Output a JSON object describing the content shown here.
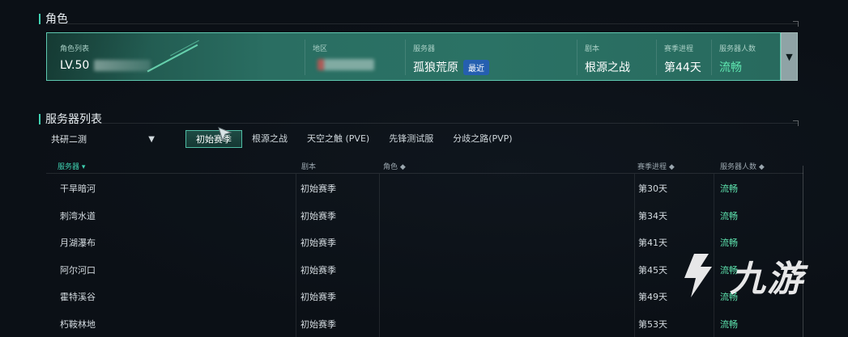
{
  "character": {
    "section_title": "角色",
    "fields": [
      {
        "label": "角色列表",
        "value": "LV.50"
      },
      {
        "label": "地区",
        "value": ""
      },
      {
        "label": "服务器",
        "value": "孤狼荒原",
        "badge": "最近"
      },
      {
        "label": "剧本",
        "value": "根源之战"
      },
      {
        "label": "赛季进程",
        "value": "第44天"
      },
      {
        "label": "服务器人数",
        "value": "流畅"
      }
    ],
    "expand_icon": "chevron-down-icon"
  },
  "server_list": {
    "section_title": "服务器列表",
    "region_select": {
      "value": "共研二测",
      "icon": "chevron-down-icon"
    },
    "tabs": [
      "初始赛季",
      "根源之战",
      "天空之触 (PVE)",
      "先锋测试服",
      "分歧之路(PVP)"
    ],
    "active_tab": 0,
    "columns": [
      "服务器",
      "剧本",
      "角色",
      "赛季进程",
      "服务器人数"
    ],
    "sort_icons": [
      "▾",
      "",
      "◆",
      "◆",
      "◆"
    ],
    "rows": [
      {
        "server": "干旱暗河",
        "script": "初始赛季",
        "role": "",
        "progress": "第30天",
        "status": "流畅"
      },
      {
        "server": "刺湾水道",
        "script": "初始赛季",
        "role": "",
        "progress": "第34天",
        "status": "流畅"
      },
      {
        "server": "月湖瀑布",
        "script": "初始赛季",
        "role": "",
        "progress": "第41天",
        "status": "流畅"
      },
      {
        "server": "阿尔河口",
        "script": "初始赛季",
        "role": "",
        "progress": "第45天",
        "status": "流畅"
      },
      {
        "server": "霍特溪谷",
        "script": "初始赛季",
        "role": "",
        "progress": "第49天",
        "status": "流畅"
      },
      {
        "server": "朽鞍林地",
        "script": "初始赛季",
        "role": "",
        "progress": "第53天",
        "status": "流畅"
      }
    ]
  },
  "watermark": {
    "text": "九游"
  },
  "colors": {
    "accent": "#3fd0b0",
    "status_green": "#5fe6b0",
    "card_bg": "#2a6e62",
    "badge_blue": "#255fb0"
  }
}
